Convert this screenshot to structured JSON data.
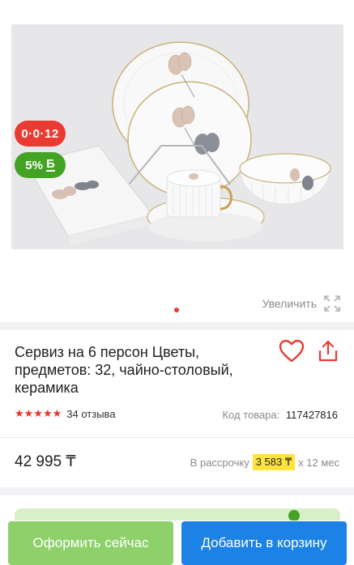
{
  "badges": {
    "installment": "0·0·12",
    "bonus_percent": "5%",
    "bonus_symbol": "Б"
  },
  "gallery": {
    "zoom_label": "Увеличить",
    "active_slide": 1
  },
  "product": {
    "title": "Сервиз на 6 персон Цветы, предметов: 32, чайно-столовый, керамика",
    "rating_stars": "★★★★★",
    "reviews": "34 отзыва",
    "sku_label": "Код товара:",
    "sku_value": "117427816"
  },
  "pricing": {
    "price": "42 995 ₸",
    "installment_prefix": "В рассрочку",
    "installment_amount": "3 583 ₸",
    "installment_suffix": "x 12 мес"
  },
  "actions": {
    "buy_now": "Оформить сейчас",
    "add_to_cart": "Добавить в корзину"
  },
  "colors": {
    "accent_red": "#ea3b33",
    "bonus_green": "#44a325",
    "buy_button": "#8ed16b",
    "cart_button": "#1d82e6",
    "installment_highlight": "#ffe33d"
  }
}
